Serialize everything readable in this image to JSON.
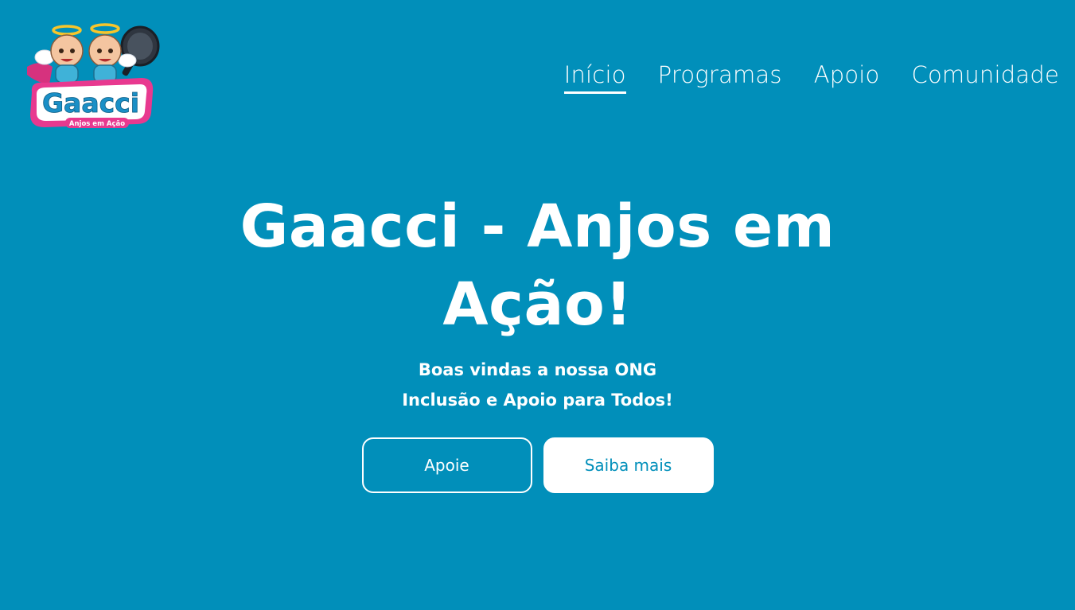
{
  "brand": {
    "logo_name": "Gaacci",
    "logo_tagline": "Anjos em Ação"
  },
  "nav": {
    "items": [
      {
        "label": "Início",
        "active": true
      },
      {
        "label": "Programas",
        "active": false
      },
      {
        "label": "Apoio",
        "active": false
      },
      {
        "label": "Comunidade",
        "active": false
      }
    ]
  },
  "hero": {
    "title": "Gaacci - Anjos em Ação!",
    "subtitle_1": "Boas vindas a nossa ONG",
    "subtitle_2": "Inclusão e Apoio para Todos!",
    "primary_button": "Apoie",
    "secondary_button": "Saiba mais"
  },
  "colors": {
    "background": "#018fba",
    "text": "#ffffff",
    "logo_pink": "#e8398f",
    "logo_blue": "#1a8fc6"
  }
}
